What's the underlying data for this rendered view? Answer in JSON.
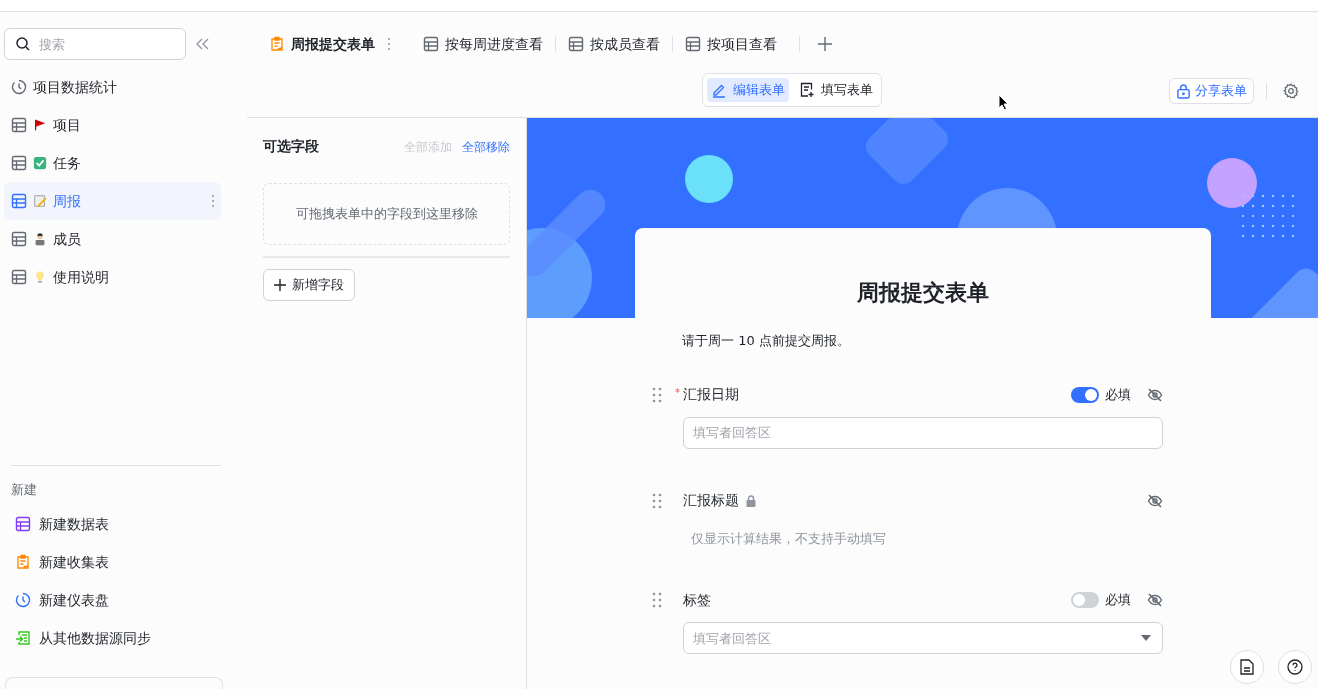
{
  "sidebar": {
    "search": {
      "placeholder": "搜索"
    },
    "items": [
      {
        "kind": "dashboard",
        "label": "项目数据统计",
        "selected": false
      },
      {
        "kind": "table",
        "label": "项目",
        "selected": false
      },
      {
        "kind": "table",
        "label": "任务",
        "selected": false
      },
      {
        "kind": "table",
        "label": "周报",
        "selected": true
      },
      {
        "kind": "table",
        "label": "成员",
        "selected": false
      },
      {
        "kind": "table",
        "label": "使用说明",
        "selected": false
      }
    ],
    "new_section": {
      "title": "新建",
      "items": [
        {
          "kind": "table",
          "label": "新建数据表"
        },
        {
          "kind": "form",
          "label": "新建收集表"
        },
        {
          "kind": "dashboard",
          "label": "新建仪表盘"
        },
        {
          "kind": "sync",
          "label": "从其他数据源同步"
        }
      ]
    }
  },
  "tabs": [
    {
      "kind": "form",
      "label": "周报提交表单",
      "selected": true
    },
    {
      "kind": "table",
      "label": "按每周进度查看",
      "selected": false
    },
    {
      "kind": "table",
      "label": "按成员查看",
      "selected": false
    },
    {
      "kind": "table",
      "label": "按项目查看",
      "selected": false
    }
  ],
  "mode_switch": [
    {
      "kind": "edit",
      "label": "编辑表单",
      "selected": true
    },
    {
      "kind": "fill",
      "label": "填写表单",
      "selected": false
    }
  ],
  "share_button": "分享表单",
  "fields_panel": {
    "title": "可选字段",
    "add_all": "全部添加",
    "remove_all": "全部移除",
    "drop_hint": "可拖拽表单中的字段到这里移除",
    "new_field": "新增字段"
  },
  "form": {
    "title": "周报提交表单",
    "description": "请于周一 10 点前提交周报。",
    "fields": [
      {
        "kind": "input",
        "label": "汇报日期",
        "required_mark": "*",
        "required": true,
        "locked": false,
        "placeholder": "填写者回答区",
        "required_label": "必填"
      },
      {
        "kind": "computed",
        "label": "汇报标题",
        "required": false,
        "locked": true,
        "note": "仅显示计算结果，不支持手动填写"
      },
      {
        "kind": "select",
        "label": "标签",
        "required": false,
        "locked": false,
        "placeholder": "填写者回答区",
        "required_label": "必填"
      }
    ]
  }
}
